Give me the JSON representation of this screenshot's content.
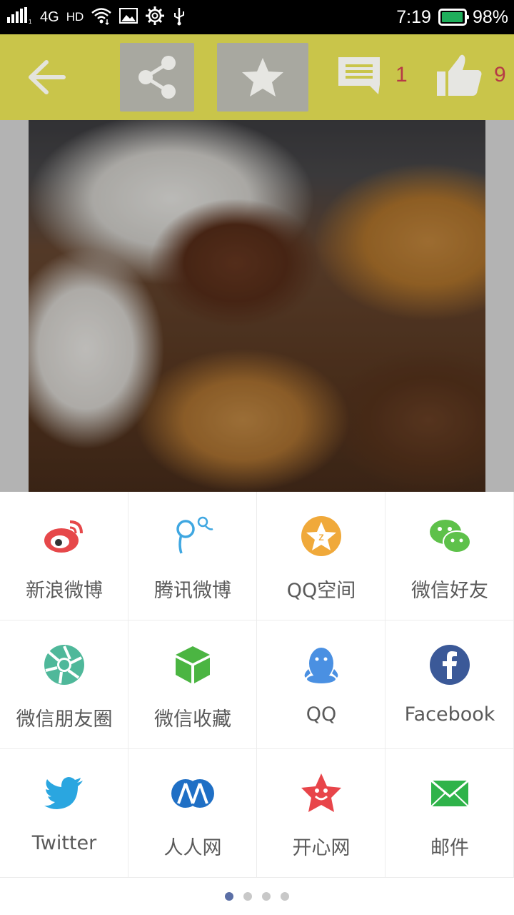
{
  "status_bar": {
    "network": "4G",
    "hd": "HD",
    "time": "7:19",
    "battery_percent_text": "98%",
    "battery_level": 0.98,
    "battery_color": "#1fae5b"
  },
  "toolbar": {
    "background": "#c9c54a",
    "comment_count": "1",
    "like_count": "9",
    "icons": [
      "back-arrow-icon",
      "share-icon",
      "star-icon",
      "comment-icon",
      "thumbs-up-icon"
    ]
  },
  "share_sheet": {
    "items": [
      {
        "label": "新浪微博",
        "icon": "sina-weibo-icon",
        "color": "#e6484a"
      },
      {
        "label": "腾讯微博",
        "icon": "tencent-weibo-icon",
        "color": "#3fa7e1"
      },
      {
        "label": "QQ空间",
        "icon": "qzone-icon",
        "color": "#f0a93a"
      },
      {
        "label": "微信好友",
        "icon": "wechat-icon",
        "color": "#5ec14a"
      },
      {
        "label": "微信朋友圈",
        "icon": "wechat-moments-icon",
        "color": "#4fb89a"
      },
      {
        "label": "微信收藏",
        "icon": "wechat-favorite-icon",
        "color": "#4bb542"
      },
      {
        "label": "QQ",
        "icon": "qq-icon",
        "color": "#4a90e2"
      },
      {
        "label": "Facebook",
        "icon": "facebook-icon",
        "color": "#3b5998"
      },
      {
        "label": "Twitter",
        "icon": "twitter-icon",
        "color": "#2aa6e0"
      },
      {
        "label": "人人网",
        "icon": "renren-icon",
        "color": "#1f6fc5"
      },
      {
        "label": "开心网",
        "icon": "kaixin-icon",
        "color": "#e8454a"
      },
      {
        "label": "邮件",
        "icon": "mail-icon",
        "color": "#2fb34a"
      }
    ],
    "page_count": 4,
    "active_page": 1
  }
}
